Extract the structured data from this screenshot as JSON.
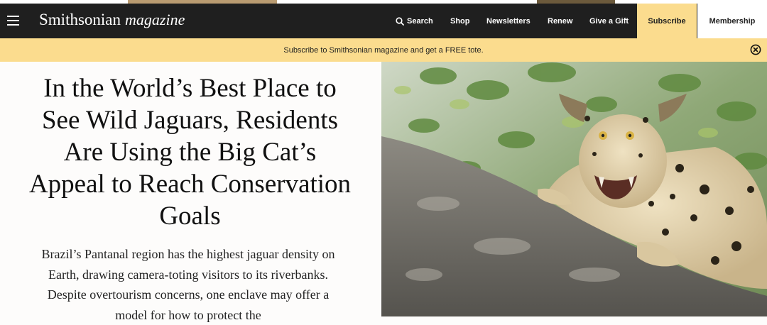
{
  "nav": {
    "logo_main": "Smithsonian",
    "logo_sub": "magazine",
    "links": {
      "search": "Search",
      "shop": "Shop",
      "newsletters": "Newsletters",
      "renew": "Renew",
      "gift": "Give a Gift"
    },
    "subscribe": "Subscribe",
    "membership": "Membership"
  },
  "promo": {
    "text": "Subscribe to Smithsonian magazine and get a FREE tote."
  },
  "article": {
    "headline": "In the World’s Best Place to See Wild Jaguars, Residents Are Using the Big Cat’s Appeal to Reach Conservation Goals",
    "dek": "Brazil’s Pantanal region has the highest jaguar density on Earth, drawing camera-toting visitors to its riverbanks. Despite overtourism concerns, one enclave may offer a model for how to protect the"
  },
  "colors": {
    "nav_bg": "#1f1f1f",
    "accent_yellow": "#fbdc8e"
  },
  "icons": {
    "menu": "hamburger-menu-icon",
    "search": "search-icon",
    "close": "close-circle-icon"
  }
}
